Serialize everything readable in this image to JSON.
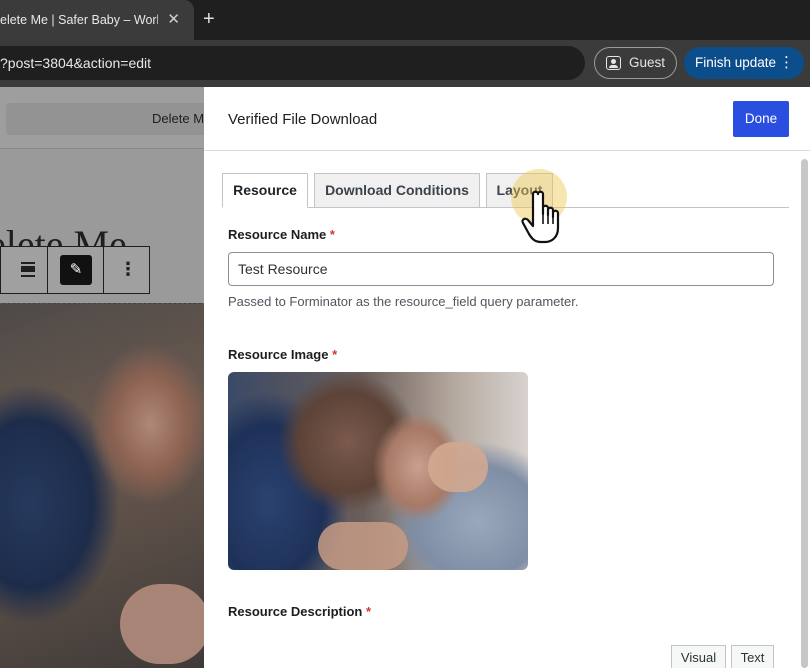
{
  "browser": {
    "tab_title": "elete Me | Safer Baby – Work",
    "tab_close": "✕",
    "new_tab": "+",
    "url": "?post=3804&action=edit",
    "guest_label": "Guest",
    "finish_update_label": "Finish update",
    "finish_menu": "⋮"
  },
  "editor": {
    "header_button": "Delete Me",
    "post_title": "elete Me",
    "toolbar": {
      "edit_glyph": "✎",
      "more_glyph": "⋮"
    }
  },
  "panel": {
    "title": "Verified File Download",
    "done_label": "Done",
    "tabs": [
      {
        "label": "Resource"
      },
      {
        "label": "Download Conditions"
      },
      {
        "label": "Layout"
      }
    ],
    "resource_name": {
      "label": "Resource Name",
      "required_mark": "*",
      "value": "Test Resource",
      "help": "Passed to Forminator as the resource_field query parameter."
    },
    "resource_image": {
      "label": "Resource Image",
      "required_mark": "*"
    },
    "resource_description": {
      "label": "Resource Description",
      "required_mark": "*",
      "mode_visual": "Visual",
      "mode_text": "Text"
    }
  },
  "colors": {
    "accent": "#2a4fe0",
    "finish_button": "#0c4d8c",
    "required": "#d63638"
  }
}
